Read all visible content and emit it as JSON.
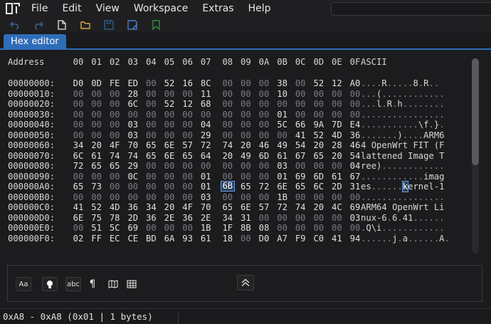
{
  "menubar": {
    "items": [
      "File",
      "Edit",
      "View",
      "Workspace",
      "Extras",
      "Help"
    ],
    "search_placeholder": ""
  },
  "toolbar": {
    "buttons": [
      "undo-icon",
      "redo-icon",
      "new-file-icon",
      "open-folder-icon",
      "save-icon",
      "save-as-icon",
      "bookmark-icon"
    ]
  },
  "tab": {
    "label": "Hex editor"
  },
  "editor": {
    "address_header": "Address",
    "columns": [
      "00",
      "01",
      "02",
      "03",
      "04",
      "05",
      "06",
      "07",
      "08",
      "09",
      "0A",
      "0B",
      "0C",
      "0D",
      "0E",
      "0F"
    ],
    "ascii_header": "ASCII",
    "selected": {
      "row": 10,
      "col": 8
    },
    "rows": [
      {
        "address": "00000000:",
        "bytes": [
          "D0",
          "0D",
          "FE",
          "ED",
          "00",
          "52",
          "16",
          "8C",
          "00",
          "00",
          "00",
          "38",
          "00",
          "52",
          "12",
          "A0"
        ],
        "ascii": "....R.....8.R.."
      },
      {
        "address": "00000010:",
        "bytes": [
          "00",
          "00",
          "00",
          "28",
          "00",
          "00",
          "00",
          "11",
          "00",
          "00",
          "00",
          "10",
          "00",
          "00",
          "00",
          "00"
        ],
        "ascii": "...(............"
      },
      {
        "address": "00000020:",
        "bytes": [
          "00",
          "00",
          "00",
          "6C",
          "00",
          "52",
          "12",
          "68",
          "00",
          "00",
          "00",
          "00",
          "00",
          "00",
          "00",
          "00"
        ],
        "ascii": "...l.R.h........"
      },
      {
        "address": "00000030:",
        "bytes": [
          "00",
          "00",
          "00",
          "00",
          "00",
          "00",
          "00",
          "00",
          "00",
          "00",
          "00",
          "01",
          "00",
          "00",
          "00",
          "00"
        ],
        "ascii": "................"
      },
      {
        "address": "00000040:",
        "bytes": [
          "00",
          "00",
          "00",
          "03",
          "00",
          "00",
          "00",
          "04",
          "00",
          "00",
          "00",
          "5C",
          "66",
          "9A",
          "7D",
          "E4"
        ],
        "ascii": "...........\\f.}."
      },
      {
        "address": "00000050:",
        "bytes": [
          "00",
          "00",
          "00",
          "03",
          "00",
          "00",
          "00",
          "29",
          "00",
          "00",
          "00",
          "00",
          "41",
          "52",
          "4D",
          "36"
        ],
        "ascii": ".......)....ARM6"
      },
      {
        "address": "00000060:",
        "bytes": [
          "34",
          "20",
          "4F",
          "70",
          "65",
          "6E",
          "57",
          "72",
          "74",
          "20",
          "46",
          "49",
          "54",
          "20",
          "28",
          "46"
        ],
        "ascii": "4 OpenWrt FIT (F"
      },
      {
        "address": "00000070:",
        "bytes": [
          "6C",
          "61",
          "74",
          "74",
          "65",
          "6E",
          "65",
          "64",
          "20",
          "49",
          "6D",
          "61",
          "67",
          "65",
          "20",
          "54"
        ],
        "ascii": "lattened Image T"
      },
      {
        "address": "00000080:",
        "bytes": [
          "72",
          "65",
          "65",
          "29",
          "00",
          "00",
          "00",
          "00",
          "00",
          "00",
          "00",
          "03",
          "00",
          "00",
          "00",
          "04"
        ],
        "ascii": "ree)............"
      },
      {
        "address": "00000090:",
        "bytes": [
          "00",
          "00",
          "00",
          "0C",
          "00",
          "00",
          "00",
          "01",
          "00",
          "00",
          "00",
          "01",
          "69",
          "6D",
          "61",
          "67"
        ],
        "ascii": "............imag"
      },
      {
        "address": "000000A0:",
        "bytes": [
          "65",
          "73",
          "00",
          "00",
          "00",
          "00",
          "00",
          "01",
          "6B",
          "65",
          "72",
          "6E",
          "65",
          "6C",
          "2D",
          "31"
        ],
        "ascii": "es......kernel-1"
      },
      {
        "address": "000000B0:",
        "bytes": [
          "00",
          "00",
          "00",
          "00",
          "00",
          "00",
          "00",
          "03",
          "00",
          "00",
          "00",
          "1B",
          "00",
          "00",
          "00",
          "00"
        ],
        "ascii": "................"
      },
      {
        "address": "000000C0:",
        "bytes": [
          "41",
          "52",
          "4D",
          "36",
          "34",
          "20",
          "4F",
          "70",
          "65",
          "6E",
          "57",
          "72",
          "74",
          "20",
          "4C",
          "69"
        ],
        "ascii": "ARM64 OpenWrt Li"
      },
      {
        "address": "000000D0:",
        "bytes": [
          "6E",
          "75",
          "78",
          "2D",
          "36",
          "2E",
          "36",
          "2E",
          "34",
          "31",
          "00",
          "00",
          "00",
          "00",
          "00",
          "03"
        ],
        "ascii": "nux-6.6.41......"
      },
      {
        "address": "000000E0:",
        "bytes": [
          "00",
          "51",
          "5C",
          "69",
          "00",
          "00",
          "00",
          "1B",
          "1F",
          "8B",
          "08",
          "00",
          "00",
          "00",
          "00",
          "00"
        ],
        "ascii": ".Q\\i............"
      },
      {
        "address": "000000F0:",
        "bytes": [
          "02",
          "FF",
          "EC",
          "CE",
          "BD",
          "6A",
          "93",
          "61",
          "18",
          "00",
          "D0",
          "A7",
          "F9",
          "C0",
          "41",
          "94"
        ],
        "ascii": "......j.a......A."
      }
    ]
  },
  "bottom_panel": {
    "buttons": [
      {
        "name": "font-size-toggle",
        "label": "Aa"
      },
      {
        "name": "lightbulb-icon",
        "label": ""
      },
      {
        "name": "abc-toggle",
        "label": "abc"
      },
      {
        "name": "pilcrow-icon",
        "label": "¶"
      },
      {
        "name": "map-icon",
        "label": ""
      },
      {
        "name": "table-icon",
        "label": ""
      },
      {
        "name": "collapse-up-icon",
        "label": ""
      }
    ]
  },
  "status": {
    "text": "0xA8 - 0xA8 (0x01 | 1 bytes)"
  },
  "colors": {
    "accent": "#2e6db8",
    "background": "#1c1c1e",
    "selection": "#6a9ee0"
  }
}
